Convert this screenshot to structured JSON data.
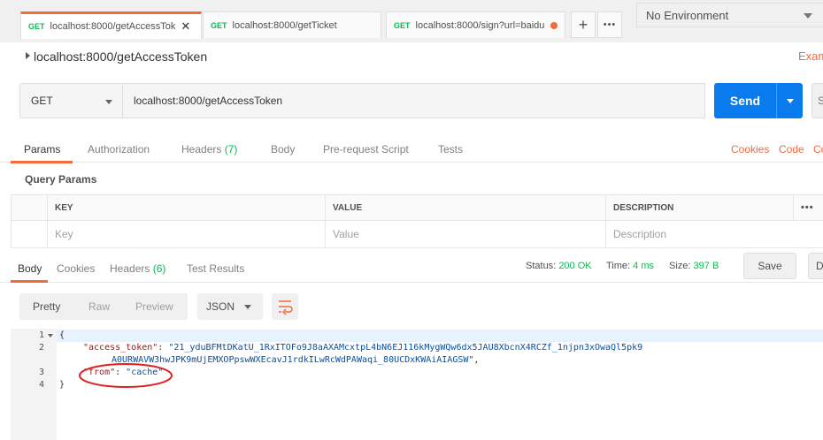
{
  "tabs": [
    {
      "method": "GET",
      "title": "localhost:8000/getAccessTok",
      "active": true,
      "close": "✕"
    },
    {
      "method": "GET",
      "title": "localhost:8000/getTicket",
      "active": false
    },
    {
      "method": "GET",
      "title": "localhost:8000/sign?url=baidu",
      "active": false,
      "unsaved": true
    }
  ],
  "tab_actions": {
    "add": "+",
    "more": "•••"
  },
  "environment": {
    "selected": "No Environment"
  },
  "request": {
    "title": "localhost:8000/getAccessToken",
    "examples_label": "Exam",
    "method": "GET",
    "url": "localhost:8000/getAccessToken",
    "send_label": "Send",
    "save_edge": "S"
  },
  "request_tabs": {
    "params": "Params",
    "authorization": "Authorization",
    "headers": "Headers",
    "headers_count": "(7)",
    "body": "Body",
    "prerequest": "Pre-request Script",
    "tests": "Tests",
    "cookies": "Cookies",
    "code": "Code",
    "comments": "Co"
  },
  "query_params": {
    "title": "Query Params",
    "columns": {
      "key": "KEY",
      "value": "VALUE",
      "description": "DESCRIPTION"
    },
    "more": "•••",
    "placeholder": {
      "key": "Key",
      "value": "Value",
      "description": "Description"
    }
  },
  "response_tabs": {
    "body": "Body",
    "cookies": "Cookies",
    "headers": "Headers",
    "headers_count": "(6)",
    "test_results": "Test Results"
  },
  "response_meta": {
    "status_label": "Status:",
    "status_value": "200 OK",
    "time_label": "Time:",
    "time_value": "4 ms",
    "size_label": "Size:",
    "size_value": "397 B",
    "save_label": "Save",
    "download_edge": "D"
  },
  "view_modes": {
    "pretty": "Pretty",
    "raw": "Raw",
    "preview": "Preview",
    "format": "JSON"
  },
  "code": {
    "line_numbers": [
      "1",
      "2",
      "3",
      "4"
    ],
    "open_brace": "{",
    "close_brace": "}",
    "access_token_key": "\"access_token\"",
    "access_token_value_1": "\"21_yduBFMtDKatU_1RxITOFo9J8aAXAMcxtpL4bN6EJ116kMygWQw6dx5JAU8XbcnX4RCZf_1njpn3xOwaQl5pk9",
    "access_token_value_2": "A0URWAVW3hwJPK9mUjEMXOPpswWXEcavJ1rdkILwRcWdPAWaqi_80UCDxKWAiAIAGSW\"",
    "from_key": "\"from\"",
    "from_value": "\"cache\"",
    "colon": ": ",
    "comma": ","
  },
  "colors": {
    "accent": "#f26b3a",
    "send": "#097bed",
    "success": "#0cbb52",
    "annotation": "#e02020"
  }
}
